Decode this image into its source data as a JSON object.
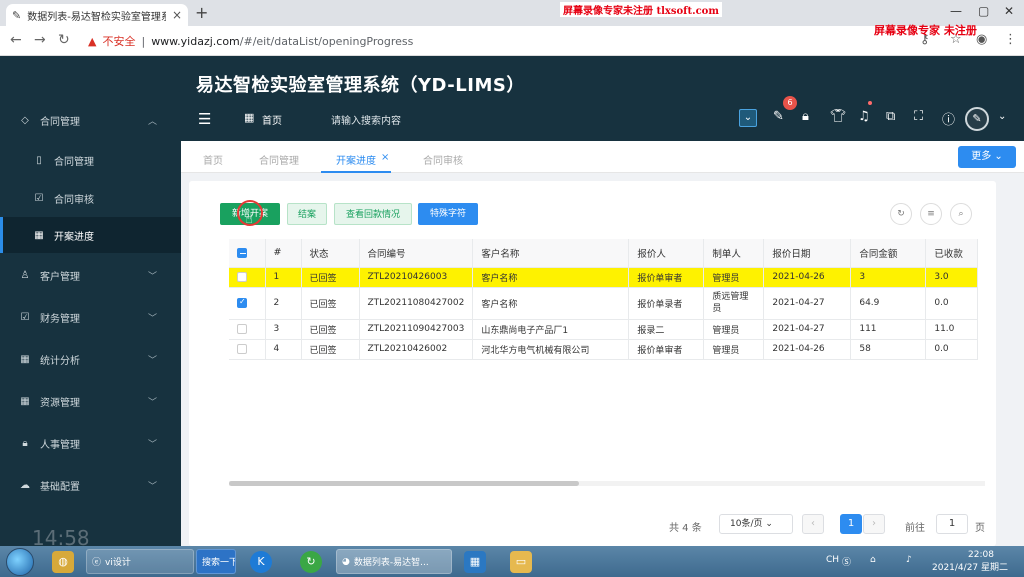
{
  "browser": {
    "tab_title": "数据列表-易达智检实验室管理系",
    "tab_close": "×",
    "new_tab": "+",
    "watermark_top": "屏幕录像专家未注册 tlxsoft.com",
    "address_warning": "不安全",
    "address_host": "www.yidazj.com",
    "address_path": "/#/eit/dataList/openingProgress",
    "watermark_right": "屏幕录像专家 未注册"
  },
  "header": {
    "title": "易达智检实验室管理系统（YD-LIMS）",
    "home_label": "首页",
    "search_placeholder": "请输入搜索内容",
    "notification_badge": "6"
  },
  "sidebar": {
    "items": [
      {
        "label": "合同管理",
        "icon": "tag-icon"
      },
      {
        "label": "合同管理",
        "icon": "file-icon"
      },
      {
        "label": "合同审核",
        "icon": "check-square-icon"
      },
      {
        "label": "开案进度",
        "icon": "grid-icon"
      },
      {
        "label": "客户管理",
        "icon": "user-icon"
      },
      {
        "label": "财务管理",
        "icon": "check-square-icon"
      },
      {
        "label": "统计分析",
        "icon": "grid-icon"
      },
      {
        "label": "资源管理",
        "icon": "grid-icon"
      },
      {
        "label": "人事管理",
        "icon": "lock-icon"
      },
      {
        "label": "基础配置",
        "icon": "cloud-icon"
      }
    ],
    "clock": "14:58"
  },
  "tabs": {
    "items": [
      "首页",
      "合同管理",
      "开案进度",
      "合同审核"
    ],
    "active_close": "×",
    "more": "更多"
  },
  "toolbar": {
    "btn_new": "新增开案",
    "btn_close": "结案",
    "btn_view": "查看回款情况",
    "btn_special": "特殊字符"
  },
  "table": {
    "headers": [
      "#",
      "状态",
      "合同编号",
      "客户名称",
      "报价人",
      "制单人",
      "报价日期",
      "合同金额",
      "已收款"
    ],
    "rows": [
      {
        "idx": "1",
        "status": "已回签",
        "no": "ZTL20210426003",
        "customer": "客户名称",
        "quoter": "报价单审者",
        "maker": "管理员",
        "date": "2021-04-26",
        "amount": "3",
        "received": "3.0"
      },
      {
        "idx": "2",
        "status": "已回签",
        "no": "ZTL20211080427002",
        "customer": "客户名称",
        "quoter": "报价单录者",
        "maker": "质远管理员",
        "date": "2021-04-27",
        "amount": "64.9",
        "received": "0.0"
      },
      {
        "idx": "3",
        "status": "已回签",
        "no": "ZTL20211090427003",
        "customer": "山东鼎尚电子产品厂1",
        "quoter": "报录二",
        "maker": "管理员",
        "date": "2021-04-27",
        "amount": "111",
        "received": "11.0"
      },
      {
        "idx": "4",
        "status": "已回签",
        "no": "ZTL20210426002",
        "customer": "河北华方电气机械有限公司",
        "quoter": "报价单审者",
        "maker": "管理员",
        "date": "2021-04-26",
        "amount": "58",
        "received": "0.0"
      }
    ]
  },
  "pagination": {
    "total": "共 4 条",
    "page_size": "10条/页",
    "current": "1",
    "goto_label": "前往",
    "goto_value": "1",
    "page_unit": "页"
  },
  "taskbar": {
    "ie_label": "vi设计",
    "search_btn": "搜索一下",
    "chrome_label": "数据列表-易达智...",
    "tray_text": "CH",
    "time": "22:08",
    "date": "2021/4/27 星期二"
  }
}
